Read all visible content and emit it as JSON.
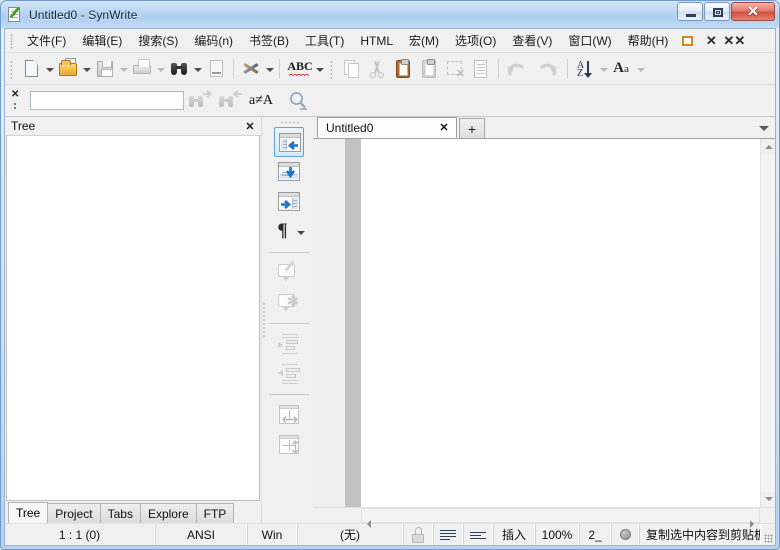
{
  "window": {
    "title": "Untitled0 - SynWrite",
    "app_icon": "document-pencil-icon",
    "controls": {
      "minimize": "minimize-icon",
      "maximize": "maximize-icon",
      "close": "✕"
    }
  },
  "menubar": {
    "items": [
      {
        "label": "文件(F)",
        "name": "menu-file"
      },
      {
        "label": "编辑(E)",
        "name": "menu-edit"
      },
      {
        "label": "搜索(S)",
        "name": "menu-search"
      },
      {
        "label": "编码(n)",
        "name": "menu-encoding"
      },
      {
        "label": "书签(B)",
        "name": "menu-bookmarks"
      },
      {
        "label": "工具(T)",
        "name": "menu-tools"
      },
      {
        "label": "HTML",
        "name": "menu-html"
      },
      {
        "label": "宏(M)",
        "name": "menu-macro"
      },
      {
        "label": "选项(O)",
        "name": "menu-options"
      },
      {
        "label": "查看(V)",
        "name": "menu-view"
      },
      {
        "label": "窗口(W)",
        "name": "menu-window"
      },
      {
        "label": "帮助(H)",
        "name": "menu-help"
      }
    ],
    "right_buttons": [
      {
        "name": "restore-window-button",
        "glyph": "orange-square-icon"
      },
      {
        "name": "close-document-button",
        "glyph": "✕"
      },
      {
        "name": "close-all-documents-button",
        "glyph": "✕✕"
      }
    ]
  },
  "toolbar": {
    "buttons": [
      {
        "name": "new-file-button",
        "icon": "new-page-icon",
        "dropdown": true,
        "enabled": true
      },
      {
        "name": "open-file-button",
        "icon": "open-folder-icon",
        "dropdown": true,
        "enabled": true
      },
      {
        "name": "save-file-button",
        "icon": "floppy-save-icon",
        "dropdown": true,
        "enabled": false
      },
      {
        "name": "print-button",
        "icon": "printer-icon",
        "dropdown": true,
        "enabled": false
      },
      {
        "name": "find-button",
        "icon": "binoculars-icon",
        "dropdown": true,
        "enabled": true
      },
      {
        "name": "goto-line-button",
        "icon": "page-bar-icon",
        "dropdown": false,
        "enabled": false
      },
      {
        "name": "tools-button",
        "icon": "wrench-screwdriver-icon",
        "dropdown": true,
        "enabled": true
      },
      {
        "name": "spellcheck-button",
        "icon": "abc-spell-icon",
        "label": "ABC",
        "dropdown": true,
        "enabled": true
      },
      {
        "name": "copy-button",
        "icon": "copy-pages-icon",
        "enabled": false
      },
      {
        "name": "cut-button",
        "icon": "scissors-icon",
        "enabled": false
      },
      {
        "name": "paste-button",
        "icon": "clipboard-icon",
        "enabled": true
      },
      {
        "name": "paste-special-button",
        "icon": "clipboard-dim-icon",
        "enabled": false
      },
      {
        "name": "delete-selection-button",
        "icon": "dashed-box-x-icon",
        "enabled": false
      },
      {
        "name": "select-all-button",
        "icon": "lines-page-icon",
        "enabled": false
      },
      {
        "name": "undo-button",
        "icon": "undo-arrow-icon",
        "enabled": false
      },
      {
        "name": "redo-button",
        "icon": "redo-arrow-icon",
        "enabled": false
      },
      {
        "name": "sort-button",
        "icon": "sort-az-icon",
        "dropdown": true,
        "enabled": false
      },
      {
        "name": "font-case-button",
        "icon": "font-case-icon",
        "dropdown": true,
        "enabled": false
      }
    ]
  },
  "findbar": {
    "close_icon": "✕",
    "input_value": "",
    "input_placeholder": "",
    "find_next": "find-next-icon",
    "find_prev": "find-previous-icon",
    "case_sensitive_label": "a≠A",
    "magnifier": "magnifier-icon"
  },
  "leftdock": {
    "header_title": "Tree",
    "header_close": "✕",
    "tabs": [
      {
        "label": "Tree",
        "active": true
      },
      {
        "label": "Project",
        "active": false
      },
      {
        "label": "Tabs",
        "active": false
      },
      {
        "label": "Explore",
        "active": false
      },
      {
        "label": "FTP",
        "active": false
      }
    ]
  },
  "vtoolbar": {
    "buttons": [
      {
        "name": "dock-left-panel-button",
        "icon": "panel-dock-left-icon",
        "selected": true
      },
      {
        "name": "dock-bottom-panel-button",
        "icon": "panel-dock-bottom-icon",
        "selected": false
      },
      {
        "name": "dock-right-panel-button",
        "icon": "panel-dock-right-icon",
        "selected": false
      },
      {
        "name": "show-special-chars-button",
        "icon": "pilcrow-icon",
        "dropdown": true,
        "selected": false
      },
      {
        "name": "add-comment-button",
        "icon": "comment-add-icon",
        "enabled": false
      },
      {
        "name": "remove-comment-button",
        "icon": "comment-remove-icon",
        "enabled": false
      },
      {
        "name": "indent-button",
        "icon": "indent-right-icon",
        "enabled": false
      },
      {
        "name": "unindent-button",
        "icon": "indent-left-icon",
        "enabled": false
      },
      {
        "name": "split-horizontal-button",
        "icon": "split-horizontal-icon",
        "enabled": false
      },
      {
        "name": "split-vertical-button",
        "icon": "split-vertical-icon",
        "enabled": false
      }
    ]
  },
  "editor": {
    "tabs": [
      {
        "label": "Untitled0",
        "close": "✕",
        "active": true
      }
    ],
    "new_tab_label": "+",
    "tab_list_dropdown": "chevron-down-icon",
    "content": ""
  },
  "statusbar": {
    "cells": [
      {
        "name": "caret-position",
        "value": "1 : 1 (0)",
        "width": 150
      },
      {
        "name": "encoding",
        "value": "ANSI",
        "width": 92
      },
      {
        "name": "line-endings",
        "value": "Win",
        "width": 50
      },
      {
        "name": "syntax-lexer",
        "value": "(无)",
        "width": 106
      },
      {
        "name": "readonly-toggle",
        "icon": "lock-icon",
        "width": 30
      },
      {
        "name": "word-wrap-toggle",
        "icon": "wrap-lines-icon",
        "width": 30
      },
      {
        "name": "unprinted-toggle",
        "icon": "align-lines-icon",
        "width": 30
      },
      {
        "name": "insert-mode",
        "value": "插入",
        "width": 42
      },
      {
        "name": "zoom-level",
        "value": "100%",
        "width": 44
      },
      {
        "name": "tab-size",
        "value": "2_",
        "width": 32
      },
      {
        "name": "macro-record-indicator",
        "icon": "record-dot-icon",
        "width": 28
      },
      {
        "name": "hint-message",
        "value": "复制选中内容到剪贴板",
        "width": 140
      }
    ]
  }
}
